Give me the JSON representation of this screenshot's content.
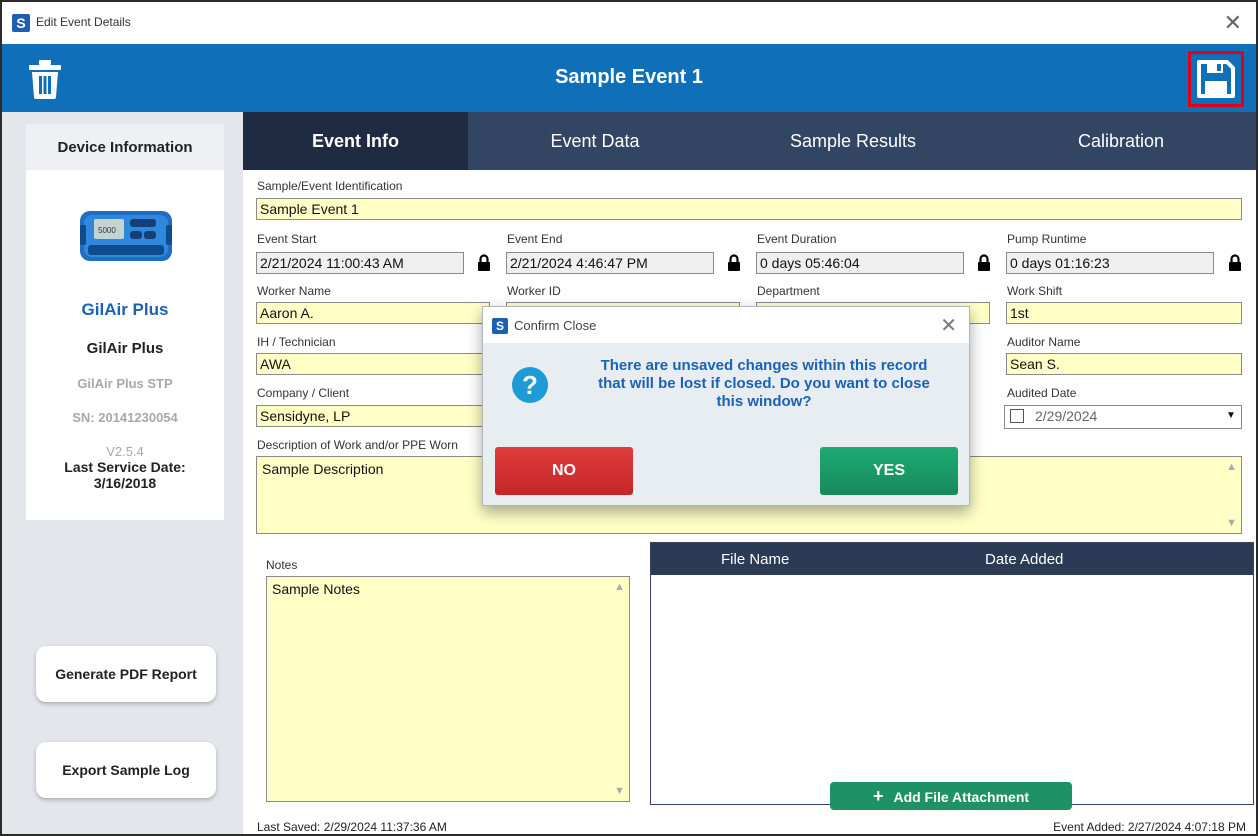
{
  "window": {
    "title": "Edit Event Details"
  },
  "header": {
    "event_title": "Sample Event 1"
  },
  "sidebar": {
    "heading": "Device Information",
    "device_name": "GilAir Plus",
    "device_model": "GilAir Plus",
    "device_variant": "GilAir Plus STP",
    "serial": "SN: 20141230054",
    "version": "V2.5.4",
    "last_service_label": "Last Service Date:",
    "last_service_date": "3/16/2018",
    "generate_pdf": "Generate PDF Report",
    "export_log": "Export Sample Log"
  },
  "tabs": [
    "Event Info",
    "Event Data",
    "Sample Results",
    "Calibration"
  ],
  "form": {
    "sample_id_label": "Sample/Event Identification",
    "sample_id": "Sample Event 1",
    "event_start_label": "Event Start",
    "event_start": "2/21/2024 11:00:43 AM",
    "event_end_label": "Event End",
    "event_end": "2/21/2024 4:46:47 PM",
    "event_duration_label": "Event Duration",
    "event_duration": "0 days 05:46:04",
    "pump_runtime_label": "Pump Runtime",
    "pump_runtime": "0 days 01:16:23",
    "worker_name_label": "Worker Name",
    "worker_name": "Aaron A.",
    "worker_id_label": "Worker ID",
    "department_label": "Department",
    "work_shift_label": "Work Shift",
    "work_shift": "1st",
    "ih_label": "IH / Technician",
    "ih": "AWA",
    "auditor_label": "Auditor Name",
    "auditor": "Sean S.",
    "company_label": "Company / Client",
    "company": "Sensidyne, LP",
    "audited_date_label": "Audited Date",
    "audited_date": "2/29/2024",
    "description_label": "Description of Work and/or PPE Worn",
    "description": "Sample Description",
    "notes_label": "Notes",
    "notes": "Sample Notes"
  },
  "attachments": {
    "col_file": "File Name",
    "col_date": "Date Added",
    "add_button": "Add File Attachment"
  },
  "footer": {
    "last_saved": "Last Saved: 2/29/2024 11:37:36 AM",
    "event_added": "Event Added: 2/27/2024 4:07:18 PM"
  },
  "dialog": {
    "title": "Confirm Close",
    "message": "There are unsaved changes within this record that will be lost if closed. Do you want to close this window?",
    "no": "NO",
    "yes": "YES"
  },
  "colors": {
    "header_blue": "#0f6fb9",
    "tab_bar": "#324563",
    "field_yellow": "#ffffc6",
    "no_red": "#d03030",
    "yes_green": "#1a9a68",
    "save_highlight": "#e1001a"
  }
}
